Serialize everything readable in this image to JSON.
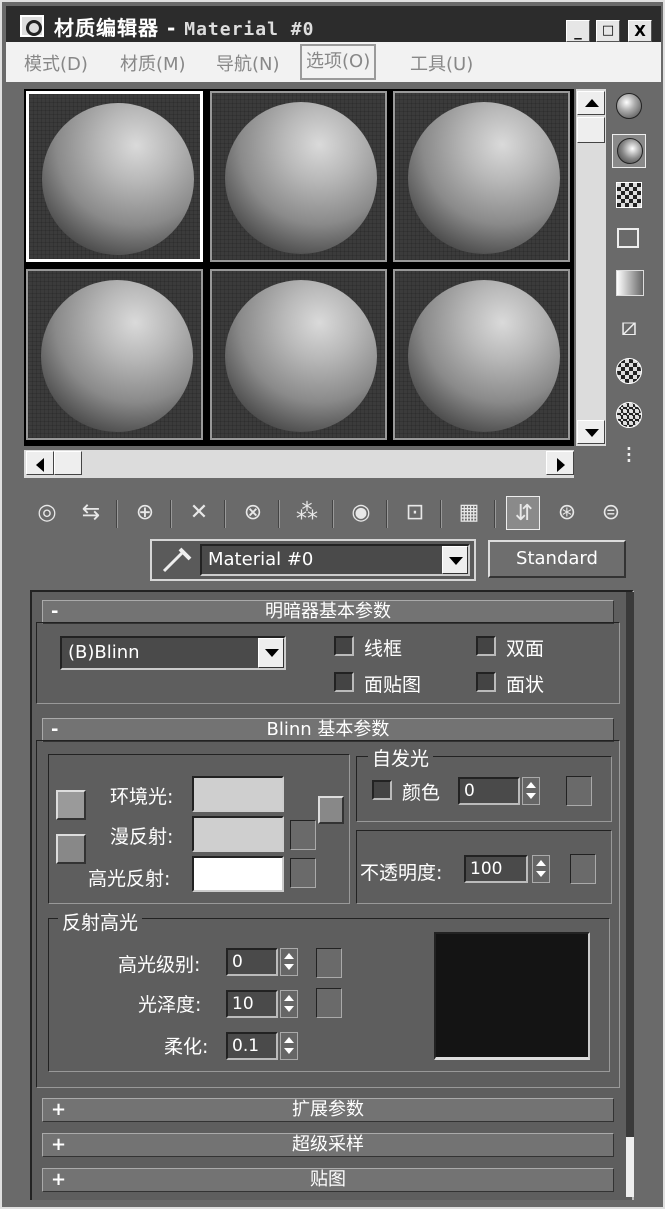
{
  "titlebar": {
    "icon": "3ds-max-icon",
    "title": "材质编辑器",
    "separator": "-",
    "subtitle": "Material #0",
    "minimize": "_",
    "maximize": "□",
    "close": "X"
  },
  "menu": {
    "items": [
      {
        "label": "模式(D)"
      },
      {
        "label": "材质(M)"
      },
      {
        "label": "导航(N)"
      },
      {
        "label": "选项(O)"
      },
      {
        "label": "工具(U)"
      }
    ]
  },
  "sample_slots": {
    "count": 6,
    "active_index": 0
  },
  "side_tools": [
    {
      "icon": "sample-type-sphere-icon"
    },
    {
      "icon": "backlight-icon"
    },
    {
      "icon": "background-checker-icon"
    },
    {
      "icon": "sample-uv-tiling-icon"
    },
    {
      "icon": "video-color-check-icon"
    },
    {
      "icon": "make-preview-icon"
    },
    {
      "icon": "options-icon"
    },
    {
      "icon": "select-by-material-icon"
    },
    {
      "icon": "material-map-navigator-icon"
    }
  ],
  "toolbar": [
    {
      "icon": "get-material-icon",
      "glyph": "◎"
    },
    {
      "icon": "put-material-to-scene-icon",
      "glyph": "⇆"
    },
    {
      "icon": "assign-material-to-selection-icon",
      "glyph": "⊕"
    },
    {
      "icon": "reset-map-icon",
      "glyph": "✕"
    },
    {
      "icon": "make-material-copy-icon",
      "glyph": "⊗"
    },
    {
      "icon": "make-unique-icon",
      "glyph": "⁂"
    },
    {
      "icon": "put-to-library-icon",
      "glyph": "◉"
    },
    {
      "icon": "material-id-channel-icon",
      "glyph": "⊡"
    },
    {
      "icon": "show-shaded-material-in-viewport-icon",
      "glyph": "▦"
    },
    {
      "icon": "show-end-result-icon",
      "glyph": "⇵"
    },
    {
      "icon": "go-to-parent-icon",
      "glyph": "⊛"
    },
    {
      "icon": "go-forward-to-sibling-icon",
      "glyph": "⊜"
    }
  ],
  "material": {
    "name": "Material #0",
    "type": "Standard"
  },
  "shader_basic": {
    "title": "明暗器基本参数",
    "toggle": "-",
    "shader": "(B)Blinn",
    "wire": "线框",
    "two_sided": "双面",
    "face_map": "面贴图",
    "faceted": "面状"
  },
  "blinn_basic": {
    "title": "Blinn 基本参数",
    "toggle": "-",
    "ambient": "环境光:",
    "diffuse": "漫反射:",
    "specular": "高光反射:",
    "ambient_color": "#cfcfcf",
    "diffuse_color": "#cfcfcf",
    "specular_color": "#ffffff",
    "self_illum": {
      "title": "自发光",
      "color_label": "颜色",
      "value": "0"
    },
    "opacity": {
      "label": "不透明度:",
      "value": "100"
    },
    "spec_highlights": {
      "title": "反射高光",
      "level_label": "高光级别:",
      "level": "0",
      "gloss_label": "光泽度:",
      "gloss": "10",
      "soften_label": "柔化:",
      "soften": "0.1"
    }
  },
  "collapsed_rollouts": [
    {
      "toggle": "+",
      "title": "扩展参数"
    },
    {
      "toggle": "+",
      "title": "超级采样"
    },
    {
      "toggle": "+",
      "title": "贴图"
    }
  ]
}
